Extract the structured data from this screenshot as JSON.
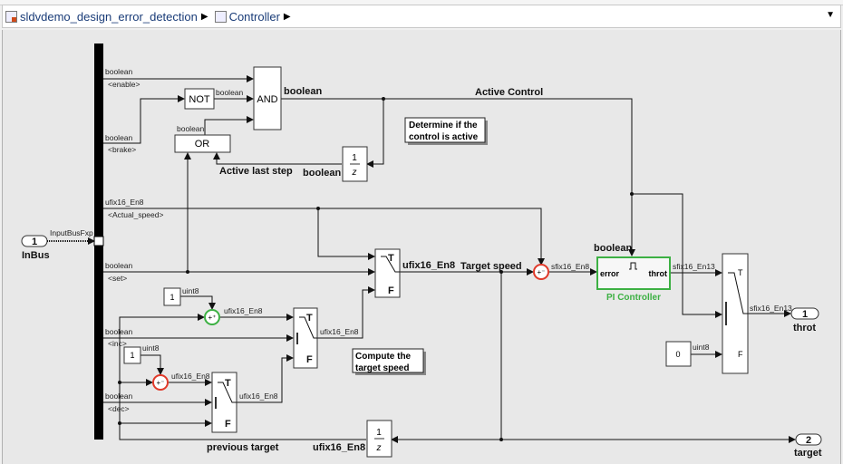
{
  "breadcrumb": {
    "items": [
      {
        "label": "sldvdemo_design_error_detection",
        "icon": "model-icon"
      },
      {
        "label": "Controller",
        "icon": "subsystem-icon"
      }
    ]
  },
  "diagram": {
    "inports": [
      {
        "number": "1",
        "name": "InBus",
        "signal": "InputBusFxp"
      }
    ],
    "outports": [
      {
        "number": "1",
        "name": "throt"
      },
      {
        "number": "2",
        "name": "target"
      }
    ],
    "bus_signals": [
      {
        "type": "boolean",
        "name": "<enable>"
      },
      {
        "type": "boolean",
        "name": "<brake>"
      },
      {
        "type": "ufix16_En8",
        "name": "<Actual_speed>"
      },
      {
        "type": "boolean",
        "name": "<set>"
      },
      {
        "type": "boolean",
        "name": "<inc>"
      },
      {
        "type": "boolean",
        "name": "<dec>"
      }
    ],
    "blocks": {
      "not": "NOT",
      "and": "AND",
      "or": "OR",
      "delay_num": "1",
      "delay_den": "z",
      "const_inc": "1",
      "const_dec": "1",
      "const_zero": "0",
      "switch_t": "T",
      "switch_f": "F",
      "pi_controller": {
        "name": "PI Controller",
        "in": "error",
        "out": "throt",
        "color": "#3cb043"
      }
    },
    "signal_labels": {
      "not_out": "boolean",
      "or_out": "boolean",
      "and_out": "boolean",
      "active_control": "Active Control",
      "active_last_step": "Active last step",
      "delay_out": "boolean",
      "switch1_out": "ufix16_En8",
      "target_speed": "Target speed",
      "err": "sfix16_En8",
      "pi_enable": "boolean",
      "pi_out": "sfix16_En13",
      "throt_out": "sfix16_En13",
      "zero_type": "uint8",
      "inc_const_type": "uint8",
      "dec_const_type": "uint8",
      "inc_sum_out": "ufix16_En8",
      "dec_sum_out": "ufix16_En8",
      "switch3_out": "ufix16_En8",
      "switch4_out": "ufix16_En8",
      "previous_target": "previous target",
      "delay2_out": "ufix16_En8"
    },
    "annotations": {
      "determine_1": "Determine if the",
      "determine_2": "control is active",
      "compute_1": "Compute the",
      "compute_2": "target speed"
    },
    "colors": {
      "add_sum": "#3cb043",
      "subtract_sum": "#e03a2a"
    }
  }
}
